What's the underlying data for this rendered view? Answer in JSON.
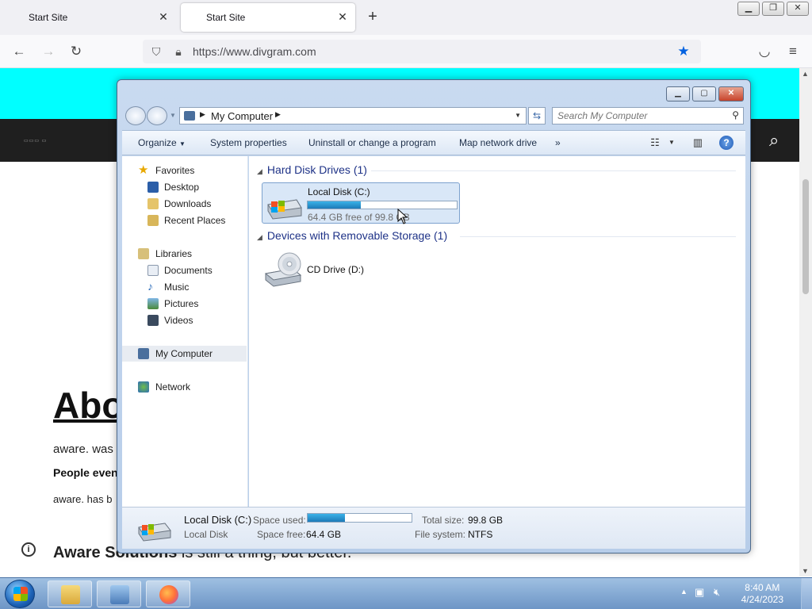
{
  "browser": {
    "tabs": [
      {
        "title": "Start Site"
      },
      {
        "title": "Start Site"
      }
    ],
    "new_tab_icon": "plus-icon",
    "url": "https://www.divgram.com"
  },
  "webpage": {
    "heading_partial": "Abo",
    "p1": "aware. was",
    "p2": "People even",
    "p3": "aware. has b",
    "p4_bold": "Aware Solutions",
    "p4_rest": " is still a thing, but better."
  },
  "explorer": {
    "address": "My Computer",
    "search_placeholder": "Search My Computer",
    "toolbar": {
      "organize": "Organize",
      "system_properties": "System properties",
      "uninstall": "Uninstall or change a program",
      "map_drive": "Map network drive",
      "more": "»"
    },
    "nav": {
      "favorites": "Favorites",
      "desktop": "Desktop",
      "downloads": "Downloads",
      "recent": "Recent Places",
      "libraries": "Libraries",
      "documents": "Documents",
      "music": "Music",
      "pictures": "Pictures",
      "videos": "Videos",
      "my_computer": "My Computer",
      "network": "Network"
    },
    "groups": {
      "hdd": "Hard Disk Drives (1)",
      "removable": "Devices with Removable Storage (1)"
    },
    "drives": {
      "c_name": "Local Disk (C:)",
      "c_free": "64.4 GB free of 99.8 GB",
      "c_used_fraction": 0.355,
      "d_name": "CD Drive (D:)"
    },
    "details": {
      "name": "Local Disk (C:)",
      "type": "Local Disk",
      "space_used_label": "Space used:",
      "space_free_label": "Space free:",
      "space_free": "64.4 GB",
      "total_label": "Total size:",
      "total": "99.8 GB",
      "fs_label": "File system:",
      "fs": "NTFS"
    }
  },
  "taskbar": {
    "time": "8:40 AM",
    "date": "4/24/2023"
  },
  "colors": {
    "cyan_banner": "#00ffff",
    "dark_nav": "#1f1f1f",
    "bookmark_star": "#0061e0",
    "disk_bar": "#1c7ab8"
  }
}
